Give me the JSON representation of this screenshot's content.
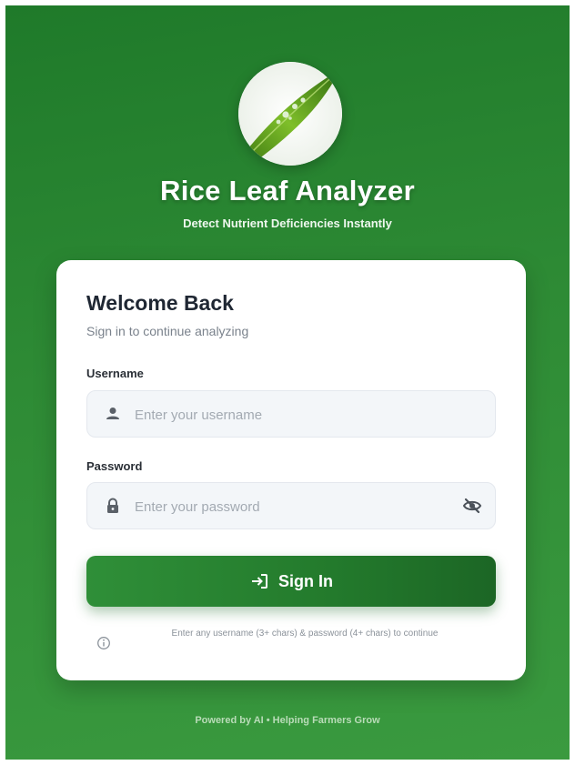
{
  "app": {
    "title": "Rice Leaf Analyzer",
    "subtitle": "Detect Nutrient Deficiencies Instantly",
    "logo_icon": "rice-leaf-icon"
  },
  "login": {
    "heading": "Welcome Back",
    "subheading": "Sign in to continue analyzing",
    "username": {
      "label": "Username",
      "placeholder": "Enter your username",
      "value": "",
      "icon": "user-icon"
    },
    "password": {
      "label": "Password",
      "placeholder": "Enter your password",
      "value": "",
      "icon": "lock-icon",
      "toggle_icon": "eye-off-icon"
    },
    "submit": {
      "label": "Sign In",
      "icon": "login-arrow-icon"
    },
    "hint": {
      "icon": "info-icon",
      "text": "Enter any username (3+ chars) & password (4+ chars) to continue"
    }
  },
  "footer": {
    "text": "Powered by AI • Helping Farmers Grow"
  },
  "colors": {
    "background_green": "#2e8b35",
    "button_green": "#237a2c",
    "card_background": "#ffffff",
    "input_background": "#f3f6f9"
  }
}
